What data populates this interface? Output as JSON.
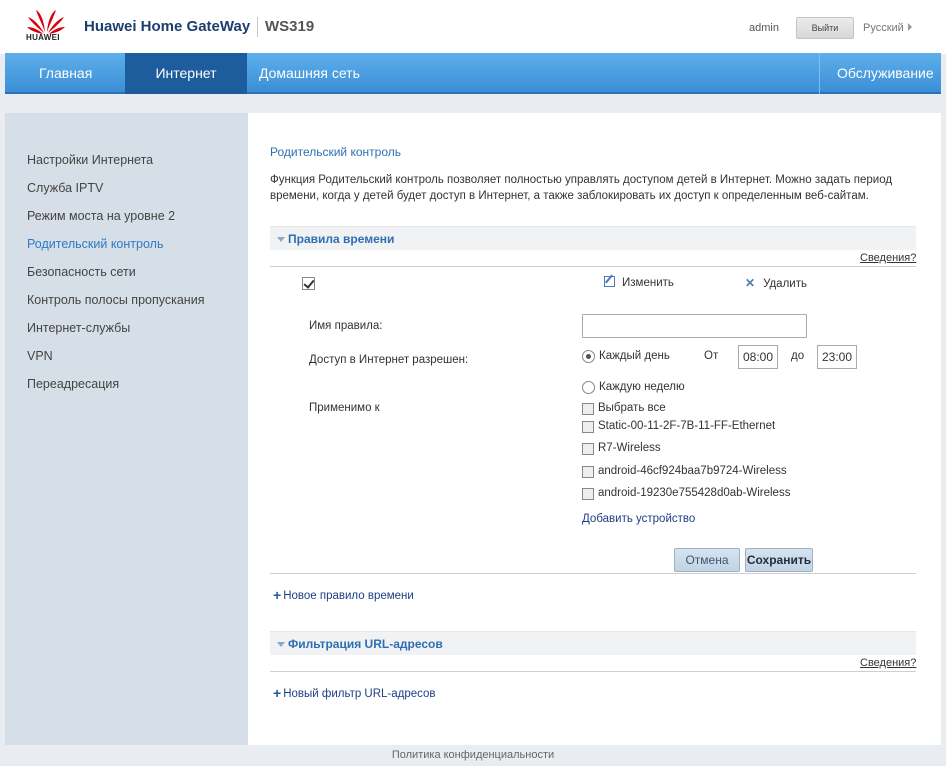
{
  "header": {
    "logo_text": "HUAWEI",
    "brand": "Huawei Home GateWay",
    "model": "WS319",
    "user": "admin",
    "logout_label": "Выйти",
    "language": "Русский"
  },
  "nav": {
    "items": [
      "Главная",
      "Интернет",
      "Домашняя сеть"
    ],
    "right_item": "Обслуживание",
    "active": "Интернет"
  },
  "sidebar": {
    "items": [
      "Настройки Интернета",
      "Служба IPTV",
      "Режим моста на уровне 2",
      "Родительский контроль",
      "Безопасность сети",
      "Контроль полосы пропускания",
      "Интернет-службы",
      "VPN",
      "Переадресация"
    ],
    "active": "Родительский контроль"
  },
  "main": {
    "title": "Родительский контроль",
    "description": "Функция Родительский контроль позволяет полностью управлять доступом детей в Интернет. Можно задать период времени, когда у детей будет доступ в Интернет, а также заблокировать их доступ к определенным веб-сайтам.",
    "time_rules": {
      "title": "Правила времени",
      "help": "Сведения?",
      "edit_label": "Изменить",
      "delete_label": "Удалить",
      "rule_name_label": "Имя правила:",
      "rule_name_value": "",
      "access_label": "Доступ в Интернет разрешен:",
      "every_day_label": "Каждый день",
      "from_label": "От",
      "from_value": "08:00",
      "to_label": "до",
      "to_value": "23:00",
      "every_week_label": "Каждую неделю",
      "applies_to_label": "Применимо к",
      "select_all_label": "Выбрать все",
      "devices": [
        "Static-00-11-2F-7B-11-FF-Ethernet",
        "R7-Wireless",
        "android-46cf924baa7b9724-Wireless",
        "android-19230e755428d0ab-Wireless"
      ],
      "add_device_label": "Добавить устройство",
      "cancel_label": "Отмена",
      "save_label": "Сохранить",
      "new_rule_label": "Новое правило времени"
    },
    "url_filter": {
      "title": "Фильтрация URL-адресов",
      "help": "Сведения?",
      "new_filter_label": "Новый фильтр URL-адресов"
    }
  },
  "footer": {
    "privacy": "Политика конфиденциальности"
  },
  "colors": {
    "nav_bg": "#3a8fd6",
    "nav_active": "#1d5d9d",
    "link": "#2e6fb3",
    "sidebar_bg": "#d6dee7"
  }
}
